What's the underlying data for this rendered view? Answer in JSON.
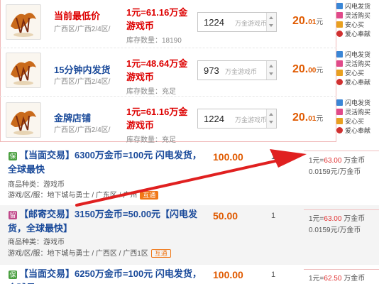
{
  "sellers": [
    {
      "name": "当前最低价",
      "location": "广西区/广西2/4区/",
      "rate_line1": "1元=61.16万金",
      "rate_line2": "游戏币",
      "stock_label": "库存数量：",
      "stock_value": "18190",
      "qty": "1224",
      "qty_unit": "万金游戏币",
      "price_int": "20.",
      "price_dec": "01",
      "price_unit": "元"
    },
    {
      "name": "15分钟内发货",
      "location": "广西区/广西2/4区/",
      "rate_line1": "1元=48.64万金",
      "rate_line2": "游戏币",
      "stock_label": "库存数量：",
      "stock_value": "充足",
      "qty": "973",
      "qty_unit": "万金游戏币",
      "price_int": "20.",
      "price_dec": "00",
      "price_unit": "元"
    },
    {
      "name": "金牌店铺",
      "location": "广西区/广西2/4区/",
      "rate_line1": "1元=61.16万金",
      "rate_line2": "游戏币",
      "stock_label": "库存数量：",
      "stock_value": "充足",
      "qty": "1224",
      "qty_unit": "万金游戏币",
      "price_int": "20.",
      "price_dec": "01",
      "price_unit": "元"
    }
  ],
  "service_tags": [
    "闪电发货",
    "灵活购买",
    "安心买",
    "爱心奉献"
  ],
  "listings": [
    {
      "badge": "保",
      "title": "【当面交易】6300万金币=100元 闪电发货，全球最快",
      "category": "商品种类：游戏币",
      "server": "游戏/区/服：地下城与勇士 / 广东区 / 广州",
      "interop": "互通",
      "price": "100.00",
      "count": "1",
      "rate_prefix": "1元=",
      "rate_value": "63.00",
      "rate_suffix": "万金币",
      "unit_price": "0.0159元/万金币"
    },
    {
      "badge": "留",
      "title": "【邮寄交易】3150万金币=50.00元【闪电发货，全球最快】",
      "category": "商品种类：游戏币",
      "server": "游戏/区/服：地下城与勇士 / 广西区 / 广西1区",
      "interop": "互通",
      "price": "50.00",
      "count": "1",
      "rate_prefix": "1元=",
      "rate_value": "63.00",
      "rate_suffix": "万金币",
      "unit_price": "0.0159元/万金币"
    },
    {
      "badge": "保",
      "title": "【当面交易】6250万金币=100元 闪电发货，全球最",
      "price": "100.00",
      "count": "1",
      "rate_prefix": "1元=",
      "rate_value": "62.50",
      "rate_suffix": "万金币"
    }
  ],
  "colors": {
    "accent_red": "#d00000",
    "price_orange": "#e05a00",
    "title_blue": "#1a4a9a",
    "arrow_red": "#e02020"
  },
  "icons": [
    "game-logo-icon",
    "spinner-up-icon",
    "spinner-down-icon",
    "flash-icon",
    "buy-icon",
    "safe-icon",
    "love-icon",
    "annotation-arrow-icon"
  ]
}
